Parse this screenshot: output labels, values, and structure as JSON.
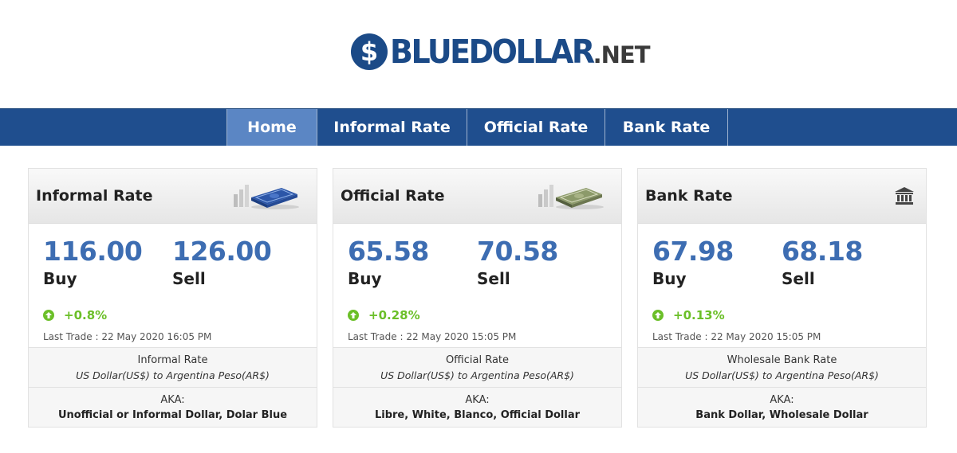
{
  "brand": {
    "logo_symbol": "$",
    "name": "BLUEDOLLAR",
    "tld": ".NET",
    "color": "#1b4a87"
  },
  "nav": {
    "items": [
      {
        "label": "Home",
        "active": true
      },
      {
        "label": "Informal Rate",
        "active": false
      },
      {
        "label": "Official Rate",
        "active": false
      },
      {
        "label": "Bank Rate",
        "active": false
      }
    ]
  },
  "cards": [
    {
      "title": "Informal Rate",
      "icon": "money-stack-icon",
      "buy_value": "116.00",
      "buy_label": "Buy",
      "sell_value": "126.00",
      "sell_label": "Sell",
      "change": "+0.8%",
      "last_trade": "Last Trade : 22 May 2020 16:05 PM",
      "rate_name": "Informal Rate",
      "pair": "US Dollar(US$) to Argentina Peso(AR$)",
      "aka_label": "AKA:",
      "aka": "Unofficial or Informal Dollar, Dolar Blue"
    },
    {
      "title": "Official Rate",
      "icon": "money-stack-icon",
      "buy_value": "65.58",
      "buy_label": "Buy",
      "sell_value": "70.58",
      "sell_label": "Sell",
      "change": "+0.28%",
      "last_trade": "Last Trade : 22 May 2020 15:05 PM",
      "rate_name": "Official Rate",
      "pair": "US Dollar(US$) to Argentina Peso(AR$)",
      "aka_label": "AKA:",
      "aka": "Libre, White, Blanco, Official Dollar"
    },
    {
      "title": "Bank Rate",
      "icon": "bank-icon",
      "buy_value": "67.98",
      "buy_label": "Buy",
      "sell_value": "68.18",
      "sell_label": "Sell",
      "change": "+0.13%",
      "last_trade": "Last Trade : 22 May 2020 15:05 PM",
      "rate_name": "Wholesale Bank Rate",
      "pair": "US Dollar(US$) to Argentina Peso(AR$)",
      "aka_label": "AKA:",
      "aka": "Bank Dollar, Wholesale Dollar"
    }
  ],
  "colors": {
    "nav_bg": "#1f4e8e",
    "nav_active": "#5b86c4",
    "rate_blue": "#3d6db2",
    "up_green": "#6bbf28"
  }
}
